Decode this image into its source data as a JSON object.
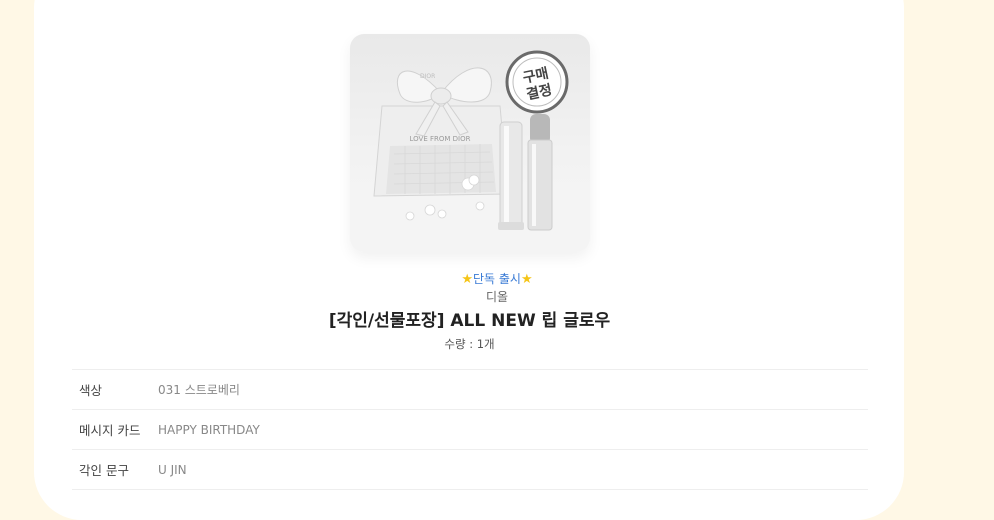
{
  "product": {
    "image_alt": "Dior lip glow with gift bag",
    "badge": [
      "구매",
      "결정"
    ],
    "exclusive_label": "단독 출시",
    "brand": "디올",
    "title": "[각인/선물포장] ALL NEW 립 글로우",
    "quantity": "수량 : 1개",
    "bag_text": "LOVE FROM DIOR",
    "bow_text": "DIOR"
  },
  "options": [
    {
      "label": "색상",
      "value": "031 스트로베리"
    },
    {
      "label": "메시지 카드",
      "value": "HAPPY BIRTHDAY"
    },
    {
      "label": "각인 문구",
      "value": "U JIN"
    }
  ],
  "colors": {
    "background": "#fff8e6",
    "card": "#ffffff",
    "accent_blue": "#3a7bd5",
    "star": "#f5c518"
  }
}
